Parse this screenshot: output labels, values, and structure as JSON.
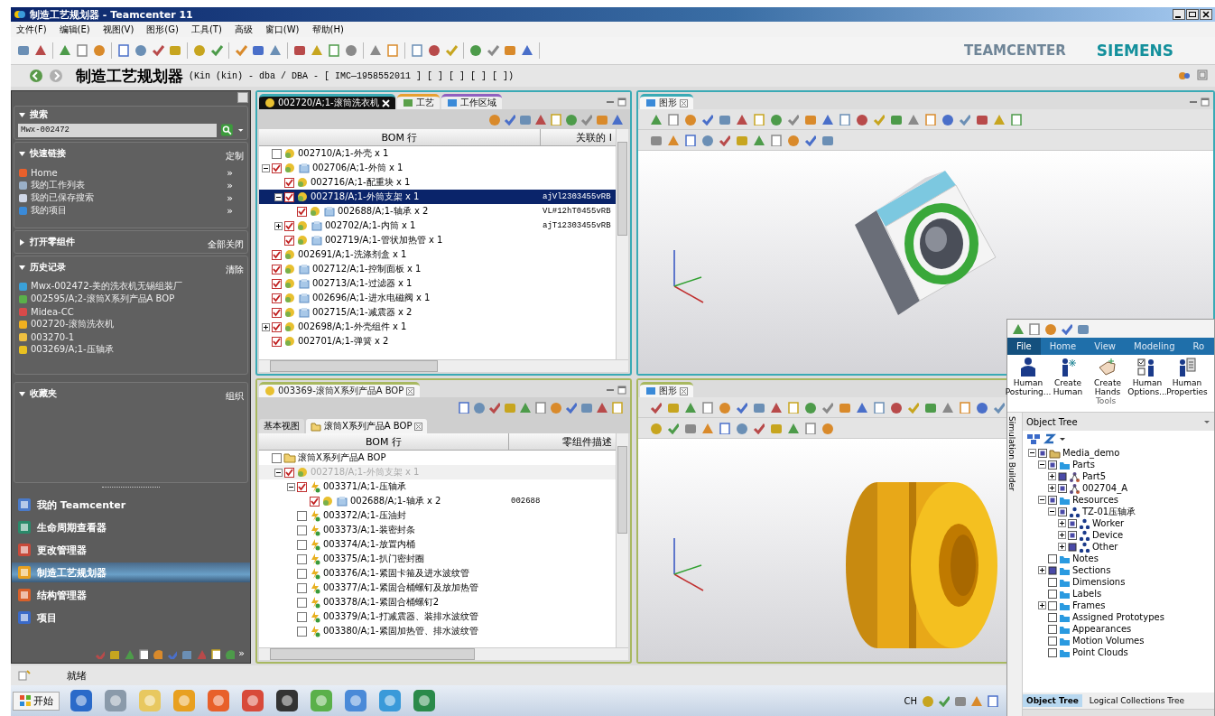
{
  "window": {
    "title": "制造工艺规划器 - Teamcenter 11"
  },
  "menu": [
    "文件(F)",
    "编辑(E)",
    "视图(V)",
    "图形(G)",
    "工具(T)",
    "高级",
    "窗口(W)",
    "帮助(H)"
  ],
  "brand": {
    "product": "TEAMCENTER",
    "company": "SIEMENS"
  },
  "perspective": {
    "title": "制造工艺规划器",
    "context": "(Kin (kin) - dba / DBA - [ IMC—1958552011 ] [ ] [ ] [ ] [ ])"
  },
  "sidebar": {
    "search": {
      "title": "搜索",
      "value": "Mwx-002472",
      "expanded": true
    },
    "quick_links": {
      "title": "快速链接",
      "action": "定制",
      "expanded": true,
      "items": [
        {
          "label": "Home",
          "action": "»"
        },
        {
          "label": "我的工作列表",
          "action": "»"
        },
        {
          "label": "我的已保存搜索",
          "action": "»"
        },
        {
          "label": "我的项目",
          "action": "»"
        }
      ]
    },
    "open_items": {
      "title": "打开零组件",
      "action": "全部关闭",
      "expanded": false
    },
    "history": {
      "title": "历史记录",
      "action": "清除",
      "expanded": true,
      "items": [
        {
          "label": "Mwx-002472-美的洗衣机无锡组装厂"
        },
        {
          "label": "002595/A;2-滚筒X系列产品A BOP"
        },
        {
          "label": "Midea-CC"
        },
        {
          "label": "002720-滚筒洗衣机"
        },
        {
          "label": "003270-1"
        },
        {
          "label": "003269/A;1-压轴承"
        }
      ]
    },
    "favorites": {
      "title": "收藏夹",
      "action": "组织",
      "expanded": true
    },
    "applications": [
      {
        "label": "我的 Teamcenter",
        "selected": false
      },
      {
        "label": "生命周期查看器",
        "selected": false
      },
      {
        "label": "更改管理器",
        "selected": false
      },
      {
        "label": "制造工艺规划器",
        "selected": true
      },
      {
        "label": "结构管理器",
        "selected": false
      },
      {
        "label": "项目",
        "selected": false
      }
    ],
    "more": "»"
  },
  "top_editor": {
    "tabs": [
      {
        "label": "002720/A;1-滚筒洗衣机",
        "selected": true
      },
      {
        "label": "工艺",
        "selected": false
      },
      {
        "label": "工作区域",
        "selected": false
      }
    ],
    "columns": [
      "BOM 行",
      "关联的 I"
    ],
    "rows": [
      {
        "label": "002710/A;1-外壳 x 1",
        "kind": "part",
        "expandable": false,
        "checked": false,
        "selected": false
      },
      {
        "label": "002706/A;1-外筒 x 1",
        "kind": "assembly",
        "expandable": true,
        "expanded": true,
        "checked": true,
        "selected": false,
        "children": [
          {
            "label": "002716/A;1-配重块 x 1",
            "kind": "part",
            "expandable": false,
            "checked": true,
            "selected": false
          },
          {
            "label": "002718/A;1-外筒支架 x 1",
            "kind": "part",
            "expandable": true,
            "expanded": true,
            "checked": true,
            "selected": true,
            "column_2": "ajVl2303455vRB",
            "children": [
              {
                "label": "002688/A;1-轴承 x 2",
                "kind": "assembly",
                "expandable": false,
                "checked": true,
                "selected": false,
                "column_2": "VL#12hT0455vRB"
              }
            ]
          },
          {
            "label": "002702/A;1-内筒 x 1",
            "kind": "assembly",
            "expandable": true,
            "expanded": false,
            "checked": true,
            "selected": false,
            "column_2": "ajT12303455vRB"
          },
          {
            "label": "002719/A;1-管状加热管 x 1",
            "kind": "assembly",
            "expandable": false,
            "checked": true,
            "selected": false
          }
        ]
      },
      {
        "label": "002691/A;1-洗涤剂盒 x 1",
        "kind": "part",
        "expandable": false,
        "checked": true,
        "selected": false
      },
      {
        "label": "002712/A;1-控制面板 x 1",
        "kind": "assembly",
        "expandable": false,
        "checked": true,
        "selected": false
      },
      {
        "label": "002713/A;1-过滤器 x 1",
        "kind": "assembly",
        "expandable": false,
        "checked": true,
        "selected": false
      },
      {
        "label": "002696/A;1-进水电磁阀 x 1",
        "kind": "assembly",
        "expandable": false,
        "checked": true,
        "selected": false
      },
      {
        "label": "002715/A;1-减震器 x 2",
        "kind": "assembly",
        "expandable": false,
        "checked": true,
        "selected": false
      },
      {
        "label": "002698/A;1-外壳组件 x 1",
        "kind": "part",
        "expandable": true,
        "expanded": false,
        "checked": true,
        "selected": false
      },
      {
        "label": "002701/A;1-弹簧 x 2",
        "kind": "part",
        "expandable": false,
        "checked": true,
        "selected": false
      }
    ]
  },
  "bottom_editor": {
    "tabs": [
      {
        "label": "003369-滚筒X系列产品A BOP",
        "selected": true
      }
    ],
    "view_tabs": [
      {
        "label": "基本视图",
        "selected": false
      },
      {
        "label": "滚筒X系列产品A BOP",
        "selected": true
      }
    ],
    "columns": [
      "BOM 行",
      "零组件描述"
    ],
    "rows": [
      {
        "label": "滚筒X系列产品A BOP",
        "kind": "bop",
        "expandable": false,
        "checked": false,
        "selected": false,
        "dimmed": false,
        "children": [
          {
            "label": "002718/A;1-外筒支架 x 1",
            "kind": "part",
            "expandable": true,
            "expanded": true,
            "checked": true,
            "selected": false,
            "dimmed": true,
            "children": [
              {
                "label": "003371/A;1-压轴承",
                "kind": "operation",
                "expandable": true,
                "expanded": true,
                "checked": true,
                "selected": false,
                "dimmed": false,
                "children": [
                  {
                    "label": "002688/A;1-轴承 x 2",
                    "kind": "assembly",
                    "expandable": false,
                    "checked": true,
                    "selected": false,
                    "dimmed": false,
                    "column_2": "002688"
                  }
                ]
              },
              {
                "label": "003372/A;1-压油封",
                "kind": "operation",
                "expandable": false,
                "checked": false,
                "selected": false,
                "dimmed": false
              },
              {
                "label": "003373/A;1-装密封条",
                "kind": "operation",
                "expandable": false,
                "checked": false,
                "selected": false,
                "dimmed": false
              },
              {
                "label": "003374/A;1-放置内桶",
                "kind": "operation",
                "expandable": false,
                "checked": false,
                "selected": false,
                "dimmed": false
              },
              {
                "label": "003375/A;1-扒门密封圈",
                "kind": "operation",
                "expandable": false,
                "checked": false,
                "selected": false,
                "dimmed": false
              },
              {
                "label": "003376/A;1-紧固卡箍及进水波纹管",
                "kind": "operation",
                "expandable": false,
                "checked": false,
                "selected": false,
                "dimmed": false
              },
              {
                "label": "003377/A;1-紧固合桶螺钉及放加热管",
                "kind": "operation",
                "expandable": false,
                "checked": false,
                "selected": false,
                "dimmed": false
              },
              {
                "label": "003378/A;1-紧固合桶螺钉2",
                "kind": "operation",
                "expandable": false,
                "checked": false,
                "selected": false,
                "dimmed": false
              },
              {
                "label": "003379/A;1-打减震器、装排水波纹管",
                "kind": "operation",
                "expandable": false,
                "checked": false,
                "selected": false,
                "dimmed": false
              },
              {
                "label": "003380/A;1-紧固加热管、排水波纹管",
                "kind": "operation",
                "expandable": false,
                "checked": false,
                "selected": false,
                "dimmed": false
              }
            ]
          }
        ]
      }
    ]
  },
  "viewers": [
    {
      "tab": "图形",
      "kind": "washer"
    },
    {
      "tab": "图形",
      "kind": "bearing"
    }
  ],
  "simulation_window": {
    "ribbon_tabs": [
      {
        "label": "File",
        "selected": true
      },
      {
        "label": "Home",
        "selected": false
      },
      {
        "label": "View",
        "selected": false
      },
      {
        "label": "Modeling",
        "selected": false
      },
      {
        "label": "Ro",
        "selected": false
      }
    ],
    "ribbon_buttons": [
      {
        "label": "Human Posturing...",
        "kind": "posture"
      },
      {
        "label": "Create Human",
        "kind": "create"
      },
      {
        "label": "Create Hands",
        "kind": "hands"
      },
      {
        "label": "Human Options...",
        "kind": "options"
      },
      {
        "label": "Human Properties",
        "kind": "properties"
      }
    ],
    "ribbon_group": "Tools",
    "side_tab": "Simulation Builder",
    "tree_title": "Object Tree",
    "tree": [
      {
        "label": "Media_demo",
        "kind": "root",
        "expandable": true,
        "expanded": true,
        "checked": true,
        "partial": true,
        "children": [
          {
            "label": "Parts",
            "kind": "folder",
            "expandable": true,
            "expanded": true,
            "checked": true,
            "partial": true,
            "children": [
              {
                "label": "Part5",
                "kind": "part",
                "expandable": true,
                "expanded": false,
                "checked": true,
                "partial": false
              },
              {
                "label": "002704_A",
                "kind": "part",
                "expandable": true,
                "expanded": false,
                "checked": true,
                "partial": true
              }
            ]
          },
          {
            "label": "Resources",
            "kind": "folder",
            "expandable": true,
            "expanded": true,
            "checked": true,
            "partial": true,
            "children": [
              {
                "label": "TZ-01压轴承",
                "kind": "resource",
                "expandable": true,
                "expanded": true,
                "checked": true,
                "partial": true,
                "children": [
                  {
                    "label": "Worker",
                    "kind": "resource",
                    "expandable": true,
                    "expanded": false,
                    "checked": true,
                    "partial": true
                  },
                  {
                    "label": "Device",
                    "kind": "resource",
                    "expandable": true,
                    "expanded": false,
                    "checked": true,
                    "partial": true
                  },
                  {
                    "label": "Other",
                    "kind": "resource",
                    "expandable": true,
                    "expanded": false,
                    "checked": true,
                    "partial": false
                  }
                ]
              }
            ]
          },
          {
            "label": "Notes",
            "kind": "folder",
            "expandable": false,
            "checked": false,
            "partial": false
          },
          {
            "label": "Sections",
            "kind": "folder",
            "expandable": true,
            "expanded": false,
            "checked": true,
            "partial": false
          },
          {
            "label": "Dimensions",
            "kind": "folder",
            "expandable": false,
            "checked": false,
            "partial": false
          },
          {
            "label": "Labels",
            "kind": "folder",
            "expandable": false,
            "checked": false,
            "partial": false
          },
          {
            "label": "Frames",
            "kind": "folder",
            "expandable": true,
            "expanded": false,
            "checked": false,
            "partial": false
          },
          {
            "label": "Assigned Prototypes",
            "kind": "folder",
            "expandable": false,
            "checked": false,
            "partial": false
          },
          {
            "label": "Appearances",
            "kind": "folder",
            "expandable": false,
            "checked": false,
            "partial": false
          },
          {
            "label": "Motion Volumes",
            "kind": "folder",
            "expandable": false,
            "checked": false,
            "partial": false
          },
          {
            "label": "Point Clouds",
            "kind": "folder",
            "expandable": false,
            "checked": false,
            "partial": false
          }
        ]
      }
    ],
    "bottom_tabs": [
      {
        "label": "Object Tree",
        "selected": true
      },
      {
        "label": "Logical Collections Tree",
        "selected": false
      }
    ]
  },
  "status_bar": {
    "text": "就绪"
  },
  "taskbar": {
    "start": "开始",
    "tray": "CH"
  }
}
